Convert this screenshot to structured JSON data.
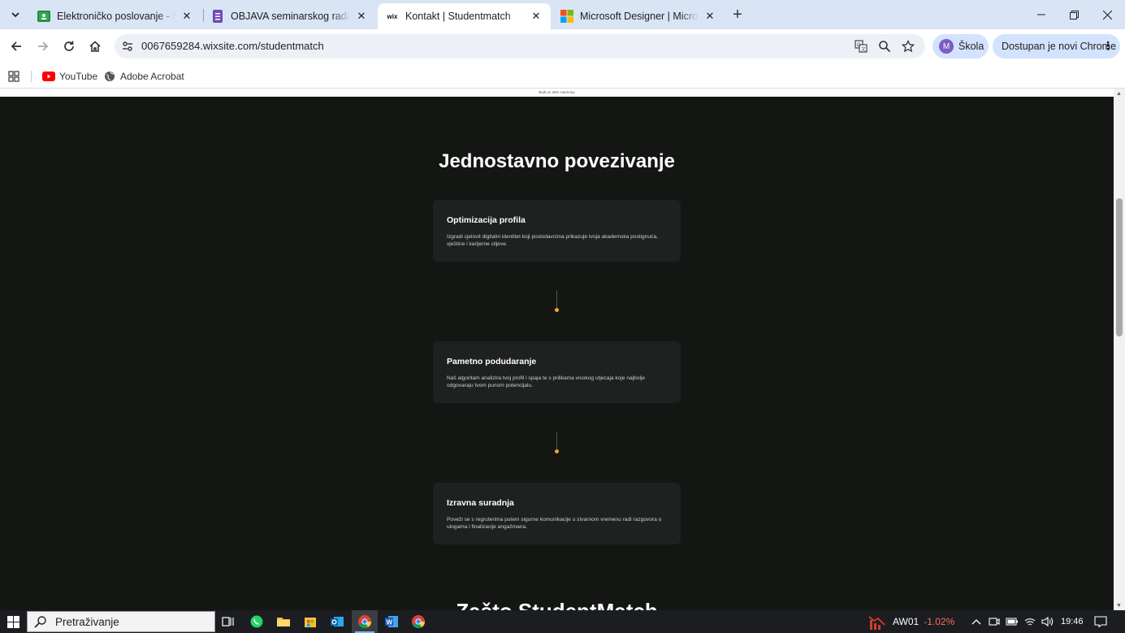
{
  "browser": {
    "tabs": [
      {
        "title": "Elektroničko poslovanje - SEMINAR",
        "favicon": "classroom-icon",
        "active": false
      },
      {
        "title": "OBJAVA seminarskog rada za kolegij",
        "favicon": "forms-icon",
        "active": false
      },
      {
        "title": "Kontakt | Studentmatch",
        "favicon": "wix-icon",
        "favicon_text": "wix",
        "active": true
      },
      {
        "title": "Microsoft Designer | Microsoft Designer",
        "favicon": "microsoft-icon",
        "active": false
      }
    ],
    "address": "0067659284.wixsite.com/studentmatch",
    "profile_initial": "M",
    "profile_name": "Škola",
    "update_label": "Dostupan je novi Chrome",
    "bookmarks": [
      {
        "label": "YouTube",
        "icon": "youtube-icon"
      },
      {
        "label": "Adobe Acrobat",
        "icon": "globe-icon"
      }
    ]
  },
  "page": {
    "wix_banner": "Built on WIX Harmony",
    "section_title": "Jednostavno povezivanje",
    "cards": [
      {
        "title": "Optimizacija profila",
        "text": "Izgradi cjelovit digitalni identitet koji poslodavcima prikazuje tvoja akademska postignuća, vještine i karijerne ciljeve."
      },
      {
        "title": "Pametno podudaranje",
        "text": "Naš algoritam analizira tvoj profil i spaja te s prilikama visokog utjecaja koje najbolje odgovaraju tvom punom potencijalu."
      },
      {
        "title": "Izravna suradnja",
        "text": "Poveži se s regruterima putem sigurne komunikacije u stvarnom vremenu radi razgovora o ulogama i finalizacije angažmana."
      }
    ],
    "next_section_title": "Zašto StudentMatch",
    "accent_color": "#f2a51f",
    "background_color": "#141614"
  },
  "taskbar": {
    "search_placeholder": "Pretraživanje",
    "stock_name": "AW01",
    "stock_change": "-1.02%",
    "time": "19:46"
  }
}
